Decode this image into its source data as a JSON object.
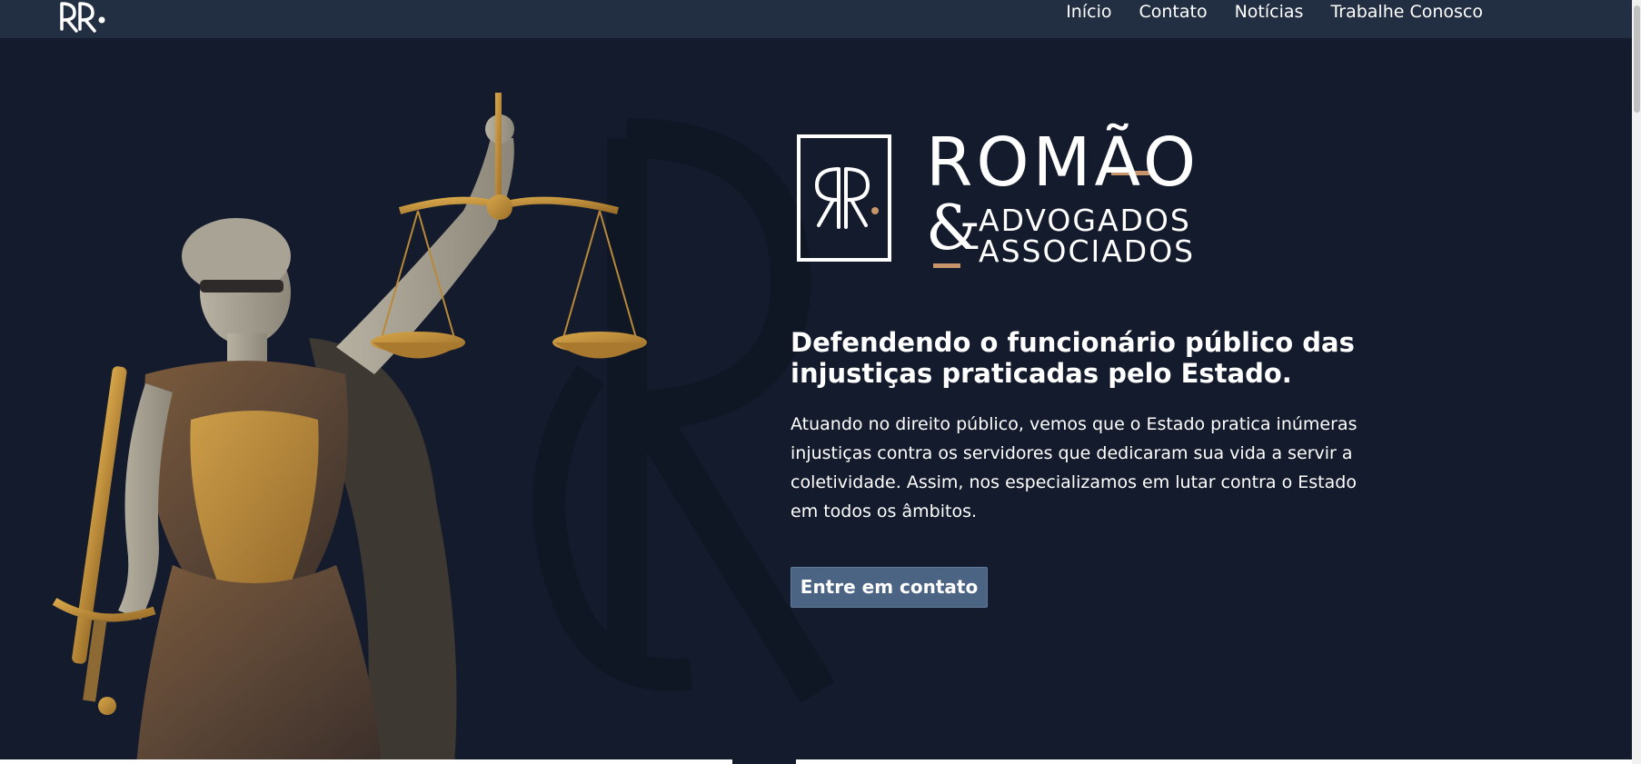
{
  "nav": {
    "items": [
      "Início",
      "Contato",
      "Notícias",
      "Trabalhe Conosco"
    ]
  },
  "logo": {
    "name": "ROMÃO",
    "amp": "&",
    "line1": "ADVOGADOS",
    "line2": "ASSOCIADOS"
  },
  "hero": {
    "headline": "Defendendo o funcionário público das injustiças praticadas pelo Estado.",
    "paragraph": "Atuando no direito público, vemos que o Estado pratica inúmeras injustiças contra os servidores que dedicaram sua vida a servir a coletividade. Assim, nos especializamos em lutar contra o Estado em todos os âmbitos.",
    "cta_label": "Entre em contato"
  },
  "colors": {
    "background": "#131b2c",
    "header": "#222e42",
    "accent_gold": "#c8956a",
    "button": "#4b6483",
    "text": "#ffffff"
  },
  "icons": {
    "brand": "rr-monogram-icon",
    "statue": "lady-justice-image"
  }
}
